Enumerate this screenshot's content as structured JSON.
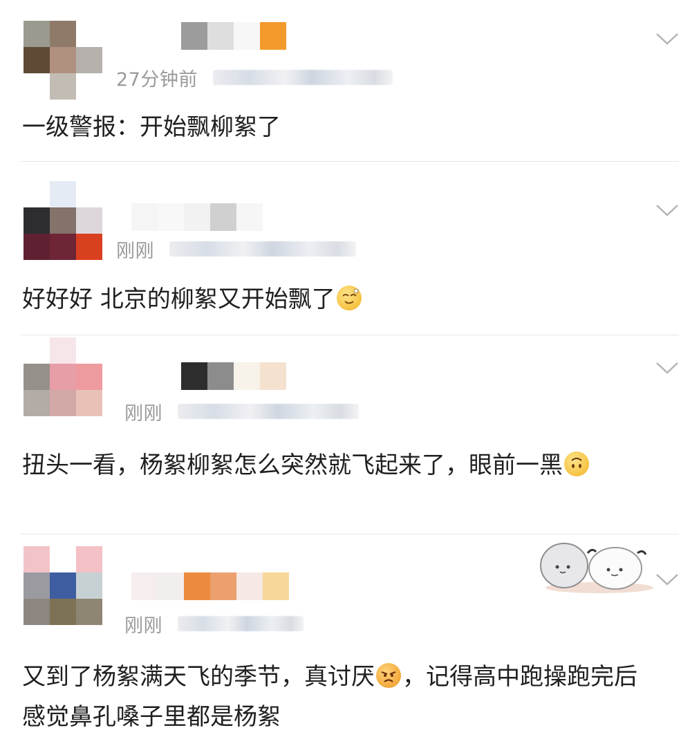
{
  "comments": [
    {
      "time": "27分钟前",
      "text": "一级警报：开始飘柳絮了",
      "emoji": "",
      "avatar_colors": [
        "#9a9a8e",
        "#8f7a6a",
        "#ffffff",
        "#5f4a36",
        "#b0907e",
        "#b7b1ad",
        "#ffffff",
        "#c2bcb4",
        "#ffffff"
      ],
      "name_colors": [
        "#ffffff",
        "#9c9c9c",
        "#dedede",
        "#f7f7f7",
        "#f39a2c"
      ]
    },
    {
      "time": "刚刚",
      "text": "好好好 北京的柳絮又开始飘了",
      "emoji": "sleepy-smile-emoji",
      "avatar_colors": [
        "#ffffff",
        "#e4ebf5",
        "#ffffff",
        "#2d2d2f",
        "#84736b",
        "#ddd7dc",
        "#5f2032",
        "#6e2535",
        "#d9401f"
      ],
      "name_colors": [
        "#f5f5f5",
        "#f8f8f8",
        "#f2f2f2",
        "#d0d0d0",
        "#f6f6f6"
      ]
    },
    {
      "time": "刚刚",
      "text": "扭头一看，杨絮柳絮怎么突然就飞起来了，眼前一黑",
      "emoji": "upside-down-face-emoji",
      "avatar_colors": [
        "#ffffff",
        "#f6e6ea",
        "#ffffff",
        "#95918a",
        "#e79ea7",
        "#ee9b9f",
        "#b3aba5",
        "#d3a9a8",
        "#e8c1b7"
      ],
      "name_colors": [
        "#ffffff",
        "#2d2d2d",
        "#8c8c8c",
        "#f7f2ea",
        "#f4e2cf"
      ]
    },
    {
      "time": "刚刚",
      "text": "又到了杨絮满天飞的季节，真讨厌",
      "text_after": "，记得高中跑操跑完后感觉鼻孔嗓子里都是杨絮",
      "emoji": "angry-face-emoji",
      "avatar_colors": [
        "#f2c4c8",
        "#ffffff",
        "#f4c1c6",
        "#9a9aa0",
        "#3f5ea2",
        "#c6d1d3",
        "#8d8580",
        "#7e7254",
        "#8e8572"
      ],
      "name_colors": [
        "#f6eeee",
        "#f3eeee",
        "#ec8a3f",
        "#eba06e",
        "#f6e8e4",
        "#f7d79a"
      ]
    }
  ],
  "icons": {
    "collapse": "chevron-down-icon"
  }
}
